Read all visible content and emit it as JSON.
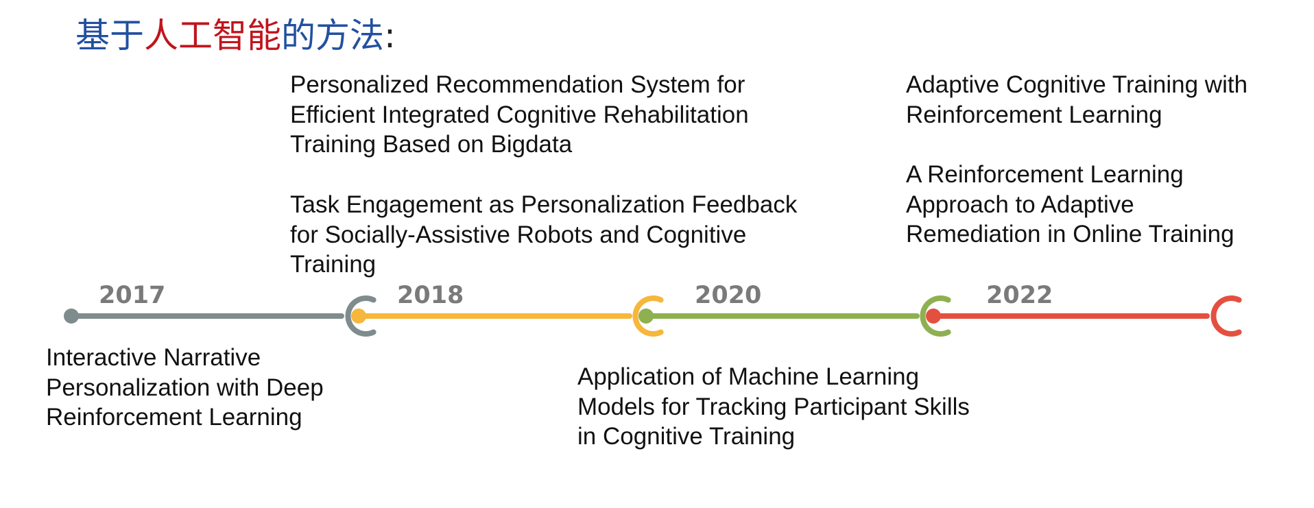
{
  "title": {
    "part1": "基于",
    "part2": "人工智能",
    "part3": "的方法",
    "part4": ":"
  },
  "colors": {
    "gray": "#7f8c8d",
    "yellow": "#f6b73c",
    "green": "#8fb050",
    "red": "#e45040"
  },
  "years": [
    "2017",
    "2018",
    "2020",
    "2022"
  ],
  "papers": {
    "p2017_narrative": "Interactive Narrative\nPersonalization with Deep\nReinforcement Learning",
    "p2018_recommendation": "Personalized Recommendation System for\nEfficient Integrated Cognitive Rehabilitation\nTraining Based on Bigdata",
    "p2018_engagement": "Task Engagement as Personalization Feedback\nfor Socially-Assistive Robots and Cognitive\nTraining",
    "p2020_ml": "Application of Machine Learning\nModels for Tracking Participant Skills\nin Cognitive Training",
    "p2022_adaptive": "Adaptive Cognitive Training with\nReinforcement Learning",
    "p2022_remediation": "A Reinforcement Learning\nApproach to Adaptive\nRemediation in Online Training"
  }
}
